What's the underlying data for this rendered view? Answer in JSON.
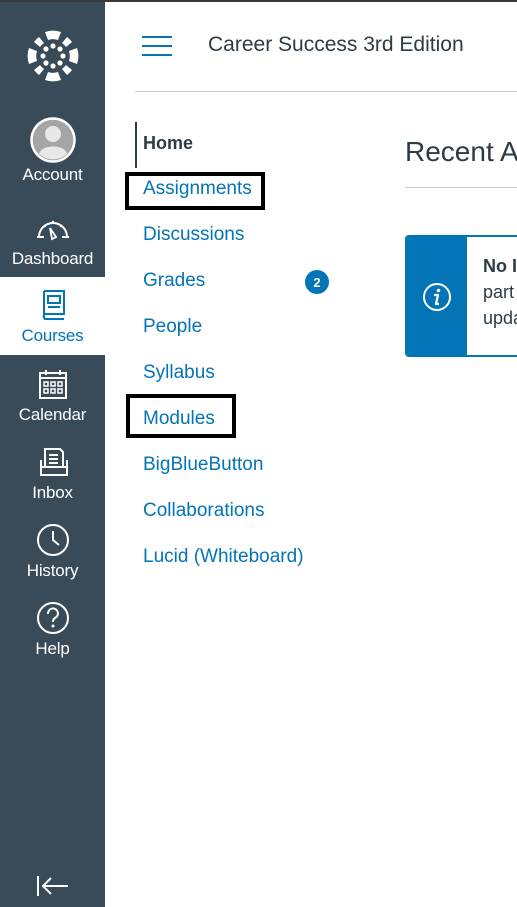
{
  "global_nav": {
    "logo": "canvas-logo-icon",
    "items": [
      {
        "label": "Account",
        "icon": "avatar-icon",
        "active": false
      },
      {
        "label": "Dashboard",
        "icon": "speedometer-icon",
        "active": false
      },
      {
        "label": "Courses",
        "icon": "book-icon",
        "active": true
      },
      {
        "label": "Calendar",
        "icon": "calendar-icon",
        "active": false
      },
      {
        "label": "Inbox",
        "icon": "inbox-icon",
        "active": false
      },
      {
        "label": "History",
        "icon": "clock-icon",
        "active": false
      },
      {
        "label": "Help",
        "icon": "question-circle-icon",
        "active": false
      }
    ],
    "collapse_icon": "collapse-nav-icon"
  },
  "header": {
    "menu_icon": "hamburger-icon",
    "course_title": "Career Success 3rd Edition"
  },
  "course_nav": {
    "items": [
      {
        "label": "Home",
        "active": true
      },
      {
        "label": "Assignments",
        "highlighted": true
      },
      {
        "label": "Discussions"
      },
      {
        "label": "Grades",
        "badge": "2"
      },
      {
        "label": "People"
      },
      {
        "label": "Syllabus"
      },
      {
        "label": "Modules",
        "highlighted": true
      },
      {
        "label": "BigBlueButton"
      },
      {
        "label": "Collaborations"
      },
      {
        "label": "Lucid (Whiteboard)"
      }
    ]
  },
  "main": {
    "recent_title": "Recent A",
    "alert": {
      "icon": "info-icon",
      "title": "No I",
      "line1": "part",
      "line2": "upda"
    }
  },
  "colors": {
    "nav_bg": "#394b58",
    "brand_blue": "#0374b5",
    "text_dark": "#2d3b45"
  }
}
